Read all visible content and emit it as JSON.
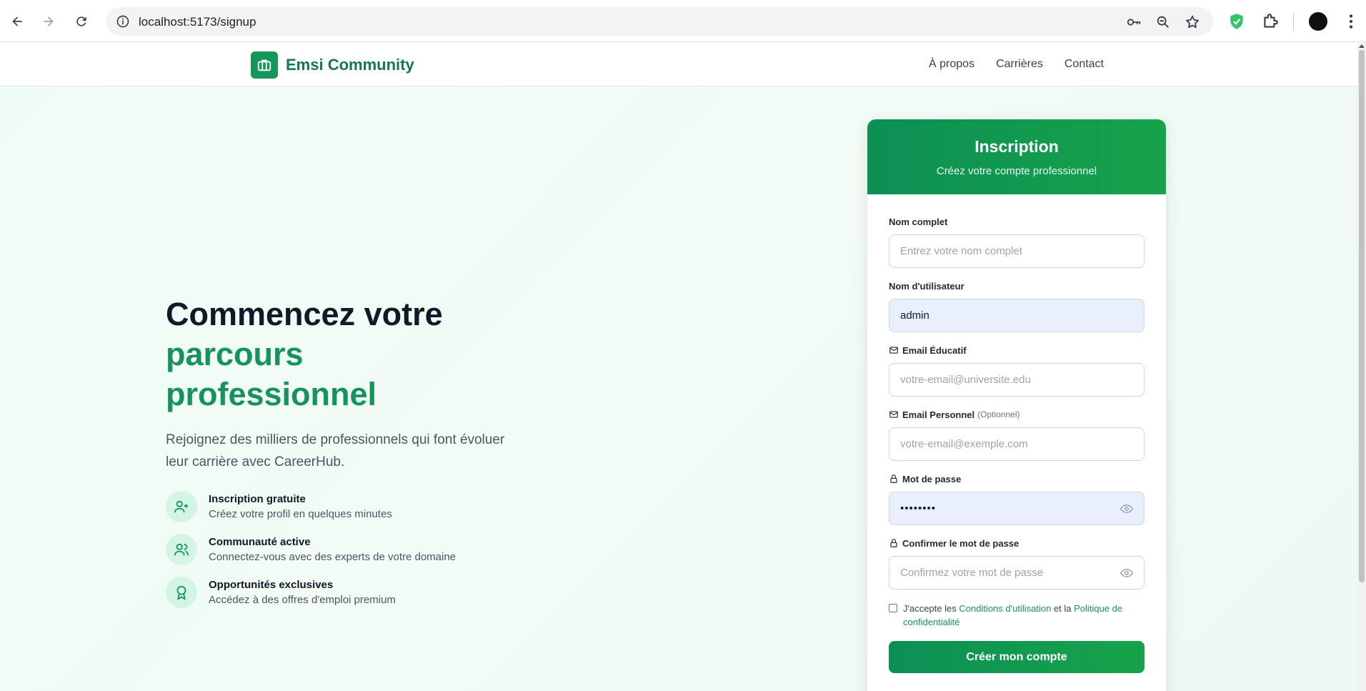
{
  "browser": {
    "url": "localhost:5173/signup",
    "icons": [
      "back-icon",
      "forward-icon",
      "reload-icon",
      "site-info-icon",
      "password-key-icon",
      "zoom-icon",
      "bookmark-star-icon",
      "shield-extension-icon",
      "extensions-puzzle-icon",
      "profile-avatar",
      "menu-dots-icon"
    ]
  },
  "navbar": {
    "brand": "Emsi Community",
    "links": [
      "À propos",
      "Carrières",
      "Contact"
    ]
  },
  "hero": {
    "title_line1": "Commencez votre",
    "title_line2": "parcours",
    "title_line3": "professionnel",
    "subtitle": "Rejoignez des milliers de professionnels qui font évoluer leur carrière avec CareerHub.",
    "features": [
      {
        "icon": "user-plus-icon",
        "title": "Inscription gratuite",
        "desc": "Créez votre profil en quelques minutes"
      },
      {
        "icon": "users-icon",
        "title": "Communauté active",
        "desc": "Connectez-vous avec des experts de votre domaine"
      },
      {
        "icon": "award-icon",
        "title": "Opportunités exclusives",
        "desc": "Accédez à des offres d'emploi premium"
      }
    ]
  },
  "form": {
    "title": "Inscription",
    "subtitle": "Créez votre compte professionnel",
    "full_name": {
      "label": "Nom complet",
      "placeholder": "Entrez votre nom complet",
      "value": ""
    },
    "username": {
      "label": "Nom d'utilisateur",
      "value": "admin"
    },
    "edu_email": {
      "label": "Email Éducatif",
      "placeholder": "votre-email@universite.edu"
    },
    "personal_email": {
      "label": "Email Personnel",
      "optional": "(Optionnel)",
      "placeholder": "votre-email@exemple.com"
    },
    "password": {
      "label": "Mot de passe",
      "masked_value": "••••••••"
    },
    "confirm_password": {
      "label": "Confirmer le mot de passe",
      "placeholder": "Confirmez votre mot de passe"
    },
    "terms": {
      "prefix": "J'accepte les ",
      "terms_link": "Conditions d'utilisation",
      "middle": " et la ",
      "privacy_link": "Politique de confidentialité",
      "checked": false
    },
    "submit": "Créer mon compte"
  },
  "colors": {
    "brand_green": "#15965a",
    "accent_text": "#16935a",
    "page_bg": "#effcf5"
  }
}
